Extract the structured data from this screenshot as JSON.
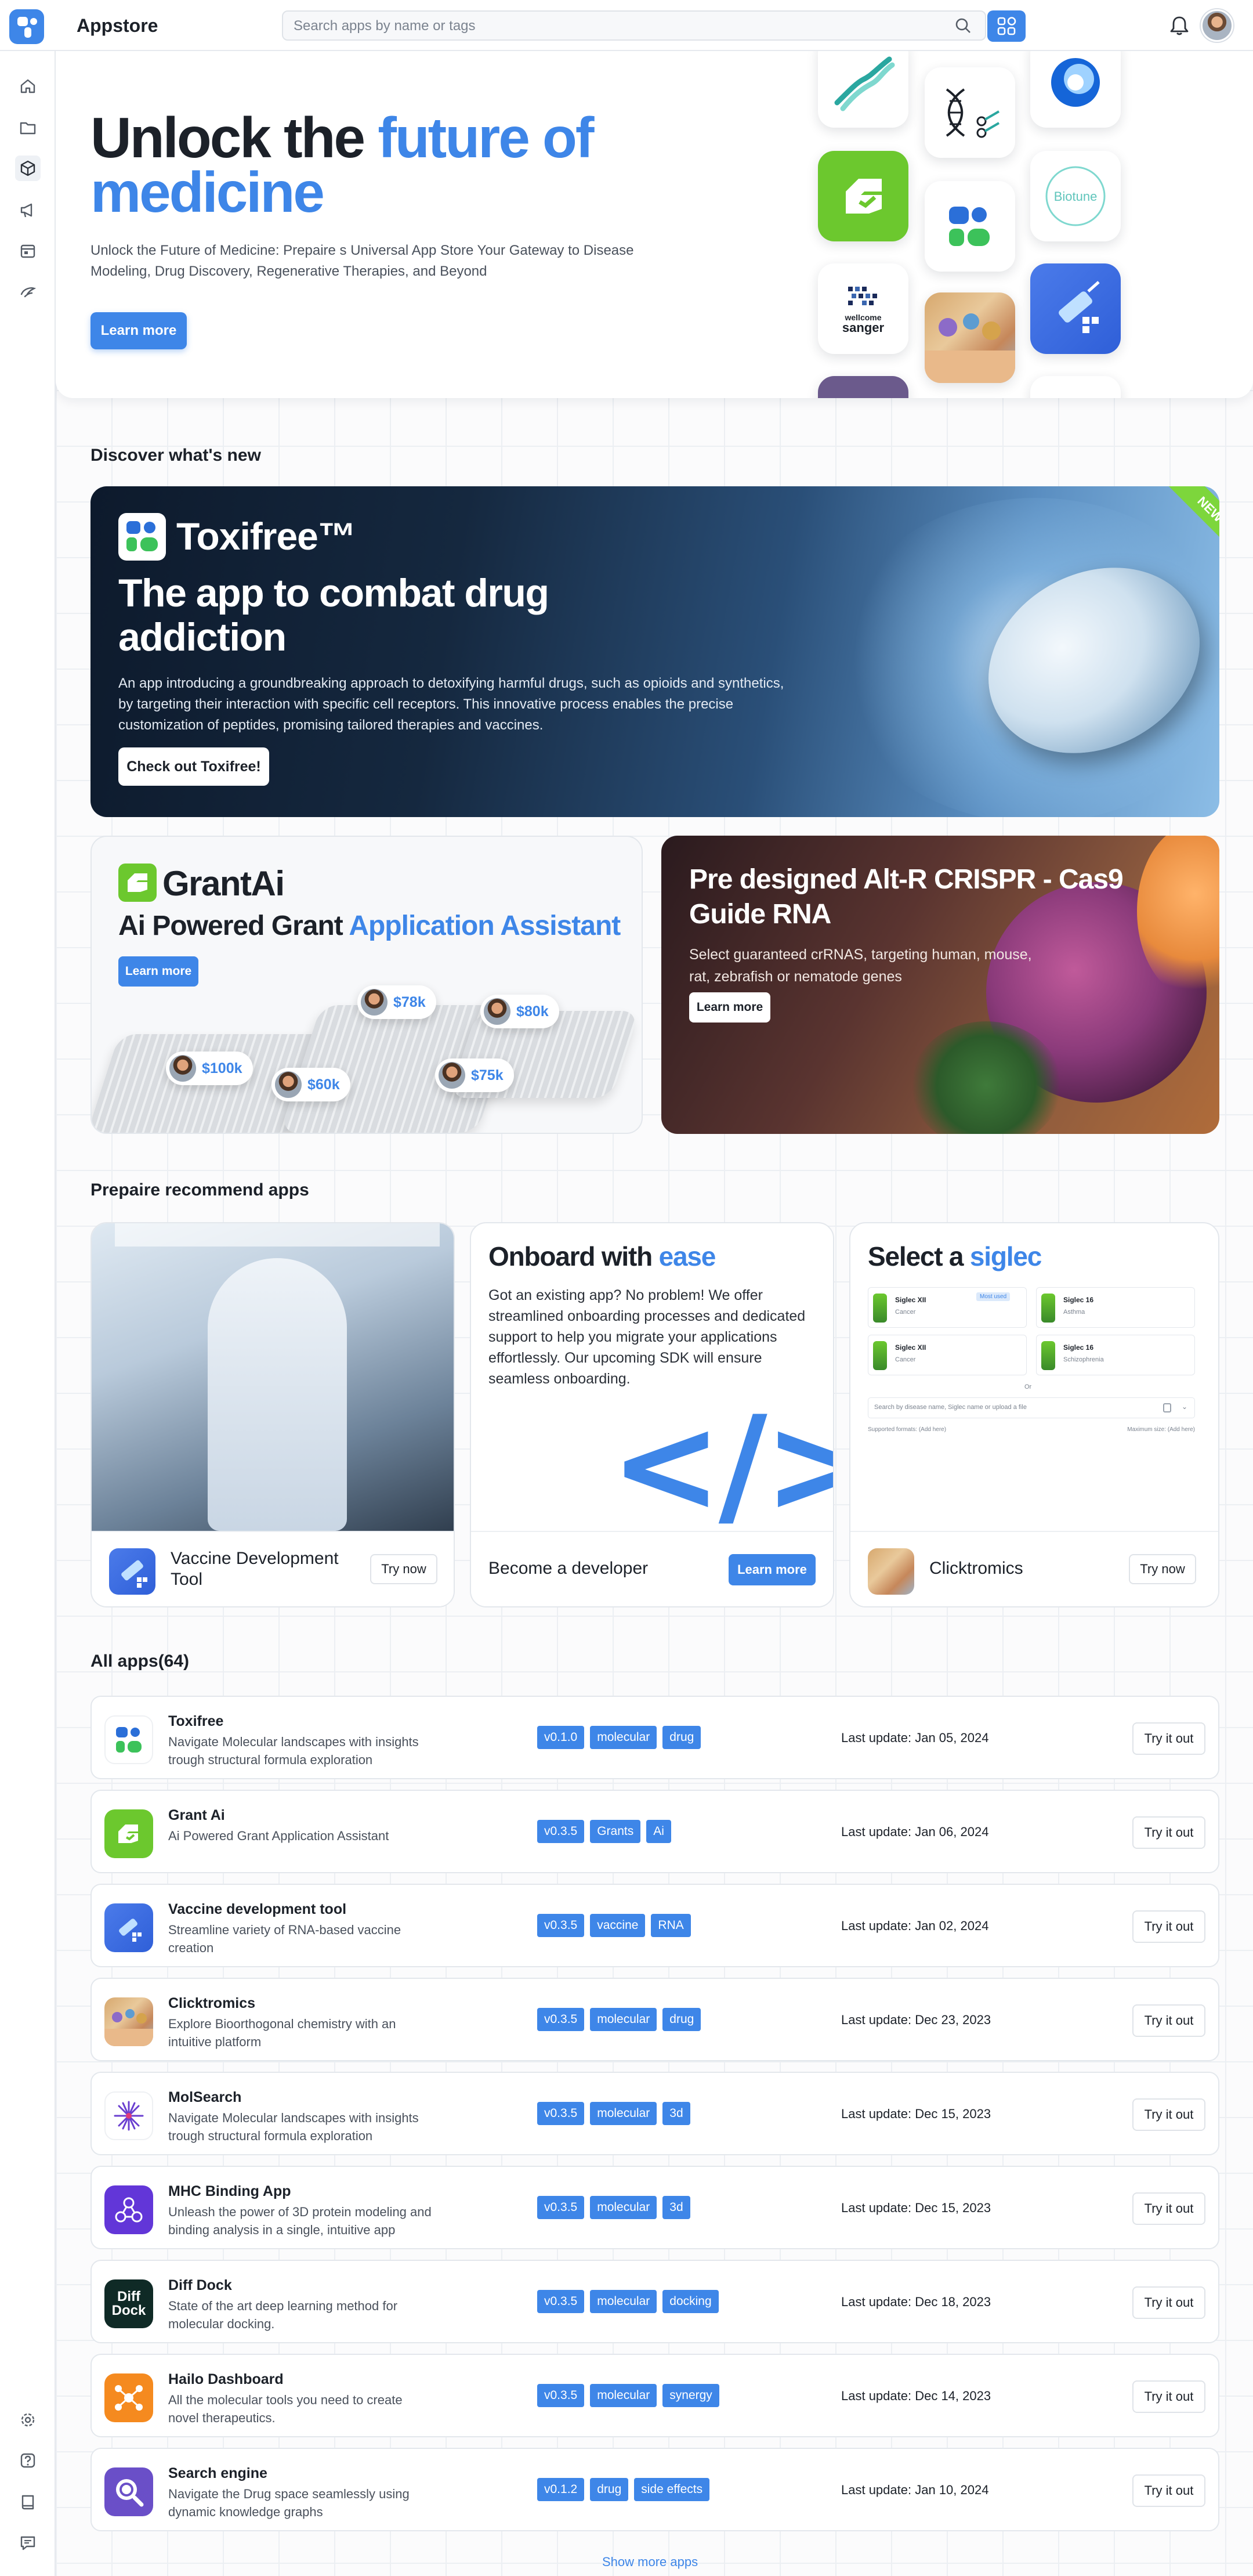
{
  "topbar": {
    "app_title": "Appstore",
    "search_placeholder": "Search apps by name or tags"
  },
  "hero": {
    "title_plain": "Unlock the ",
    "title_accent": "future of medicine",
    "subtitle": "Unlock the Future of Medicine: Prepaire s Universal App Store Your Gateway to Disease Modeling, Drug Discovery, Regenerative Therapies, and Beyond",
    "cta": "Learn more",
    "tile_biotune_label": "Biotune",
    "tile_sanger_label_1": "wellcome",
    "tile_sanger_label_2": "sanger"
  },
  "discover": {
    "heading": "Discover what's new",
    "banner": {
      "ribbon": "NEW",
      "name": "Toxifree™",
      "title": "The app to combat drug addiction",
      "description": "An app introducing a groundbreaking approach to detoxifying harmful drugs, such as opioids and synthetics, by targeting their interaction with specific cell receptors. This innovative process enables the precise customization of peptides, promising tailored therapies and vaccines.",
      "cta": "Check out Toxifree!"
    },
    "grant": {
      "name": "GrantAi",
      "tagline_plain": "Ai Powered Grant ",
      "tagline_accent": "Application Assistant",
      "cta": "Learn more",
      "salaries": [
        "$78k",
        "$80k",
        "$100k",
        "$60k",
        "$75k"
      ]
    },
    "crispr": {
      "title": "Pre designed Alt-R CRISPR - Cas9 Guide RNA",
      "description": "Select guaranteed crRNAS, targeting human, mouse, rat, zebrafish or nematode genes",
      "cta": "Learn more"
    }
  },
  "recommend": {
    "heading": "Prepaire recommend apps",
    "vaccine": {
      "name": "Vaccine Development Tool",
      "cta": "Try now"
    },
    "onboard": {
      "title_plain": "Onboard with ",
      "title_accent": "ease",
      "body": "Got an existing app? No problem! We offer streamlined onboarding processes and dedicated support to help you migrate your applications effortlessly. Our upcoming SDK will ensure seamless onboarding.",
      "code_glyph": "</>",
      "footer": "Become a developer",
      "cta": "Learn more"
    },
    "siglec": {
      "title_plain": "Select a ",
      "title_accent": "siglec",
      "mini_items": [
        {
          "name": "Siglec XII",
          "sub": "Cancer",
          "badge": "Most used"
        },
        {
          "name": "Siglec 16",
          "sub": "Asthma",
          "badge": ""
        },
        {
          "name": "Siglec XII",
          "sub": "Cancer",
          "badge": ""
        },
        {
          "name": "Siglec 16",
          "sub": "Schizophrenia",
          "badge": ""
        }
      ],
      "or": "Or",
      "mini_search": "Search by disease name, Siglec name or upload a file",
      "formats": "Supported formats: (Add here)",
      "max_size": "Maximum size: (Add here)",
      "app_name": "Clicktromics",
      "cta": "Try now"
    }
  },
  "all_apps": {
    "heading": "All apps(64)",
    "try_label": "Try it out",
    "show_more": "Show more apps",
    "rows": [
      {
        "name": "Toxifree",
        "desc": "Navigate Molecular landscapes with insights trough structural formula exploration",
        "tags": [
          "v0.1.0",
          "molecular",
          "drug"
        ],
        "update": "Last update: Jan 05, 2024"
      },
      {
        "name": "Grant Ai",
        "desc": "Ai Powered Grant Application Assistant",
        "tags": [
          "v0.3.5",
          "Grants",
          "Ai"
        ],
        "update": "Last update: Jan 06, 2024"
      },
      {
        "name": "Vaccine development tool",
        "desc": "Streamline variety of RNA-based vaccine creation",
        "tags": [
          "v0.3.5",
          "vaccine",
          "RNA"
        ],
        "update": "Last update: Jan 02, 2024"
      },
      {
        "name": "Clicktromics",
        "desc": "Explore Bioorthogonal chemistry with an intuitive platform",
        "tags": [
          "v0.3.5",
          "molecular",
          "drug"
        ],
        "update": "Last update: Dec 23, 2023"
      },
      {
        "name": "MolSearch",
        "desc": "Navigate Molecular landscapes with insights trough structural formula exploration",
        "tags": [
          "v0.3.5",
          "molecular",
          "3d"
        ],
        "update": "Last update: Dec 15, 2023"
      },
      {
        "name": "MHC Binding App",
        "desc": "Unleash the power of 3D protein modeling and binding analysis in a single, intuitive app",
        "tags": [
          "v0.3.5",
          "molecular",
          "3d"
        ],
        "update": "Last update: Dec 15, 2023"
      },
      {
        "name": "Diff Dock",
        "desc": "State of the art deep learning method for molecular docking.",
        "tags": [
          "v0.3.5",
          "molecular",
          "docking"
        ],
        "update": "Last update: Dec 18, 2023"
      },
      {
        "name": "Hailo Dashboard",
        "desc": "All the molecular tools you need to create novel therapeutics.",
        "tags": [
          "v0.3.5",
          "molecular",
          "synergy"
        ],
        "update": "Last update: Dec 14, 2023"
      },
      {
        "name": "Search engine",
        "desc": "Navigate the Drug space seamlessly using dynamic knowledge graphs",
        "tags": [
          "v0.1.2",
          "drug",
          "side effects"
        ],
        "update": "Last update: Jan 10, 2024"
      }
    ],
    "diffdock_icon_text": "Diff Dock"
  },
  "colors": {
    "accent": "#3e86e8",
    "green": "#6cc82e",
    "text": "#1c2129"
  },
  "icons": {
    "rail": [
      "home-icon",
      "folder-icon",
      "cube-icon",
      "megaphone-icon",
      "calendar-icon",
      "leaf-icon"
    ],
    "rail_bottom": [
      "settings-icon",
      "help-icon",
      "book-icon",
      "chat-icon"
    ]
  }
}
